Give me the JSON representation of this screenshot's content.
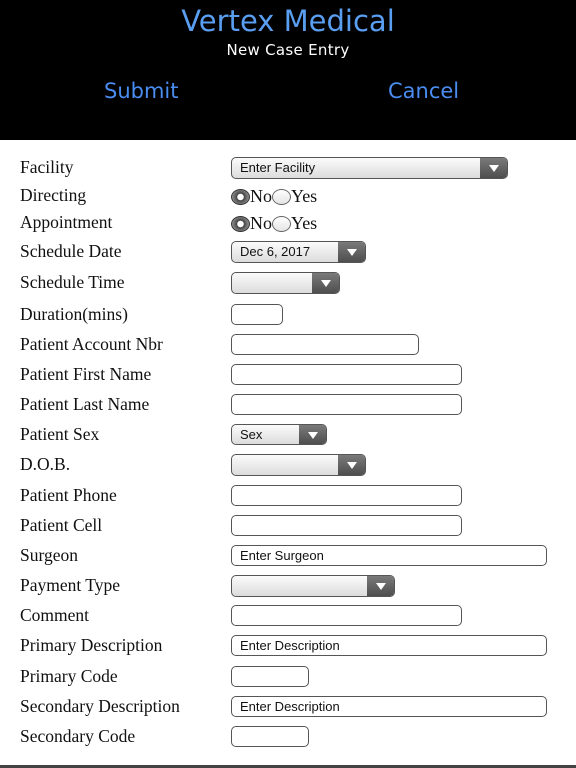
{
  "header": {
    "title": "Vertex Medical",
    "subtitle": "New Case Entry",
    "submit_label": "Submit",
    "cancel_label": "Cancel"
  },
  "colors": {
    "accent": "#5a9ef2",
    "header_bg": "#000000"
  },
  "form": {
    "facility": {
      "label": "Facility",
      "value": "Enter Facility"
    },
    "directing": {
      "label": "Directing",
      "options": [
        "No",
        "Yes"
      ],
      "selected": "No"
    },
    "appointment": {
      "label": "Appointment",
      "options": [
        "No",
        "Yes"
      ],
      "selected": "No"
    },
    "schedule_date": {
      "label": "Schedule Date",
      "value": "Dec 6, 2017"
    },
    "schedule_time": {
      "label": "Schedule Time",
      "value": ""
    },
    "duration": {
      "label": "Duration(mins)",
      "value": ""
    },
    "account_nbr": {
      "label": "Patient Account Nbr",
      "value": ""
    },
    "first_name": {
      "label": "Patient First Name",
      "value": ""
    },
    "last_name": {
      "label": "Patient Last Name",
      "value": ""
    },
    "sex": {
      "label": "Patient Sex",
      "value": "Sex"
    },
    "dob": {
      "label": "D.O.B.",
      "value": ""
    },
    "phone": {
      "label": "Patient Phone",
      "value": ""
    },
    "cell": {
      "label": "Patient Cell",
      "value": ""
    },
    "surgeon": {
      "label": "Surgeon",
      "value": "Enter Surgeon"
    },
    "payment_type": {
      "label": "Payment Type",
      "value": ""
    },
    "comment": {
      "label": "Comment",
      "value": ""
    },
    "primary_description": {
      "label": "Primary Description",
      "value": "Enter Description"
    },
    "primary_code": {
      "label": "Primary Code",
      "value": ""
    },
    "secondary_description": {
      "label": "Secondary Description",
      "value": "Enter Description"
    },
    "secondary_code": {
      "label": "Secondary Code",
      "value": ""
    }
  }
}
